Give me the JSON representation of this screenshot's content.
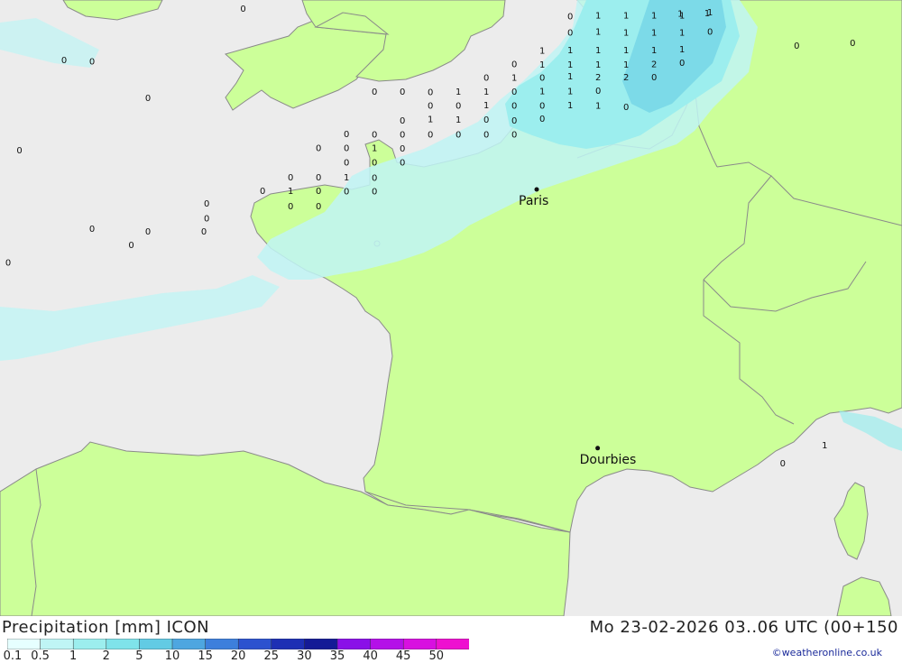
{
  "map": {
    "colors": {
      "sea": "#ececec",
      "land": "#ccff99",
      "border": "#8a8a8a"
    },
    "cities": [
      {
        "name": "Paris",
        "lon": 2.35,
        "lat": 48.85
      },
      {
        "name": "Dourbies",
        "lon": 3.44,
        "lat": 44.07
      }
    ],
    "precip_values": [
      {
        "v": "0",
        "lon": -2.9,
        "lat": 52.18
      },
      {
        "v": "0",
        "lon": -8.4,
        "lat": 51.78
      },
      {
        "v": "0",
        "lon": -7.9,
        "lat": 51.74
      },
      {
        "v": "1",
        "lon": -8.5,
        "lat": 51.43
      },
      {
        "v": "0",
        "lon": -7.9,
        "lat": 51.4
      },
      {
        "v": "0",
        "lon": -6.1,
        "lat": 51.23
      },
      {
        "v": "0",
        "lon": -5.6,
        "lat": 51.21
      },
      {
        "v": "0",
        "lon": 2.95,
        "lat": 52.04
      },
      {
        "v": "1",
        "lon": 3.45,
        "lat": 52.06
      },
      {
        "v": "1",
        "lon": 3.95,
        "lat": 52.06
      },
      {
        "v": "1",
        "lon": 4.45,
        "lat": 52.06
      },
      {
        "v": "1",
        "lon": 4.95,
        "lat": 52.06
      },
      {
        "v": "1",
        "lon": 5.45,
        "lat": 52.12
      },
      {
        "v": "0",
        "lon": 2.95,
        "lat": 51.74
      },
      {
        "v": "1",
        "lon": 3.45,
        "lat": 51.76
      },
      {
        "v": "1",
        "lon": 3.95,
        "lat": 51.74
      },
      {
        "v": "1",
        "lon": 4.45,
        "lat": 51.74
      },
      {
        "v": "1",
        "lon": 4.95,
        "lat": 51.74
      },
      {
        "v": "0",
        "lon": 5.45,
        "lat": 51.76
      },
      {
        "v": "1",
        "lon": 2.45,
        "lat": 51.41
      },
      {
        "v": "1",
        "lon": 2.95,
        "lat": 51.42
      },
      {
        "v": "1",
        "lon": 3.45,
        "lat": 51.42
      },
      {
        "v": "1",
        "lon": 3.95,
        "lat": 51.42
      },
      {
        "v": "1",
        "lon": 4.45,
        "lat": 51.42
      },
      {
        "v": "1",
        "lon": 4.95,
        "lat": 51.43
      },
      {
        "v": "0",
        "lon": 1.95,
        "lat": 51.16
      },
      {
        "v": "1",
        "lon": 2.45,
        "lat": 51.15
      },
      {
        "v": "1",
        "lon": 2.95,
        "lat": 51.15
      },
      {
        "v": "1",
        "lon": 3.45,
        "lat": 51.15
      },
      {
        "v": "1",
        "lon": 3.95,
        "lat": 51.15
      },
      {
        "v": "2",
        "lon": 4.45,
        "lat": 51.16
      },
      {
        "v": "0",
        "lon": 4.95,
        "lat": 51.18
      },
      {
        "v": "0",
        "lon": 1.45,
        "lat": 50.91
      },
      {
        "v": "1",
        "lon": 1.95,
        "lat": 50.91
      },
      {
        "v": "0",
        "lon": 2.45,
        "lat": 50.91
      },
      {
        "v": "1",
        "lon": 2.95,
        "lat": 50.93
      },
      {
        "v": "2",
        "lon": 3.45,
        "lat": 50.92
      },
      {
        "v": "2",
        "lon": 3.95,
        "lat": 50.92
      },
      {
        "v": "0",
        "lon": 4.45,
        "lat": 50.92
      },
      {
        "v": "0",
        "lon": -0.55,
        "lat": 50.65
      },
      {
        "v": "0",
        "lon": -0.05,
        "lat": 50.65
      },
      {
        "v": "0",
        "lon": 0.45,
        "lat": 50.64
      },
      {
        "v": "1",
        "lon": 0.95,
        "lat": 50.65
      },
      {
        "v": "1",
        "lon": 1.45,
        "lat": 50.65
      },
      {
        "v": "0",
        "lon": 1.95,
        "lat": 50.65
      },
      {
        "v": "1",
        "lon": 2.45,
        "lat": 50.66
      },
      {
        "v": "1",
        "lon": 2.95,
        "lat": 50.66
      },
      {
        "v": "0",
        "lon": 3.45,
        "lat": 50.67
      },
      {
        "v": "0",
        "lon": -4.6,
        "lat": 50.53
      },
      {
        "v": "0",
        "lon": 0.45,
        "lat": 50.39
      },
      {
        "v": "0",
        "lon": 0.95,
        "lat": 50.39
      },
      {
        "v": "1",
        "lon": 1.45,
        "lat": 50.4
      },
      {
        "v": "0",
        "lon": 1.95,
        "lat": 50.39
      },
      {
        "v": "0",
        "lon": 2.45,
        "lat": 50.39
      },
      {
        "v": "1",
        "lon": 2.95,
        "lat": 50.4
      },
      {
        "v": "1",
        "lon": 3.45,
        "lat": 50.39
      },
      {
        "v": "0",
        "lon": 3.95,
        "lat": 50.37
      },
      {
        "v": "0",
        "lon": -0.05,
        "lat": 50.12
      },
      {
        "v": "1",
        "lon": 0.45,
        "lat": 50.14
      },
      {
        "v": "1",
        "lon": 0.95,
        "lat": 50.13
      },
      {
        "v": "0",
        "lon": 1.45,
        "lat": 50.13
      },
      {
        "v": "0",
        "lon": 1.95,
        "lat": 50.12
      },
      {
        "v": "0",
        "lon": 2.45,
        "lat": 50.15
      },
      {
        "v": "0",
        "lon": -1.05,
        "lat": 49.87
      },
      {
        "v": "0",
        "lon": -0.55,
        "lat": 49.86
      },
      {
        "v": "0",
        "lon": -0.05,
        "lat": 49.86
      },
      {
        "v": "0",
        "lon": 0.45,
        "lat": 49.86
      },
      {
        "v": "0",
        "lon": 0.95,
        "lat": 49.86
      },
      {
        "v": "0",
        "lon": 1.45,
        "lat": 49.86
      },
      {
        "v": "0",
        "lon": 1.95,
        "lat": 49.86
      },
      {
        "v": "0",
        "lon": -7.4,
        "lat": 49.6
      },
      {
        "v": "0",
        "lon": -6.9,
        "lat": 49.57
      },
      {
        "v": "0",
        "lon": -1.55,
        "lat": 49.61
      },
      {
        "v": "0",
        "lon": -1.05,
        "lat": 49.61
      },
      {
        "v": "1",
        "lon": -0.55,
        "lat": 49.61
      },
      {
        "v": "0",
        "lon": -0.05,
        "lat": 49.6
      },
      {
        "v": "0",
        "lon": -1.05,
        "lat": 49.34
      },
      {
        "v": "0",
        "lon": -0.55,
        "lat": 49.34
      },
      {
        "v": "0",
        "lon": -0.05,
        "lat": 49.34
      },
      {
        "v": "0",
        "lon": -2.05,
        "lat": 49.07
      },
      {
        "v": "0",
        "lon": -1.55,
        "lat": 49.07
      },
      {
        "v": "1",
        "lon": -1.05,
        "lat": 49.07
      },
      {
        "v": "0",
        "lon": -0.55,
        "lat": 49.06
      },
      {
        "v": "0",
        "lon": -2.55,
        "lat": 48.82
      },
      {
        "v": "1",
        "lon": -2.05,
        "lat": 48.82
      },
      {
        "v": "0",
        "lon": -1.55,
        "lat": 48.82
      },
      {
        "v": "0",
        "lon": -1.05,
        "lat": 48.81
      },
      {
        "v": "0",
        "lon": -0.55,
        "lat": 48.81
      },
      {
        "v": "0",
        "lon": -3.55,
        "lat": 48.58
      },
      {
        "v": "0",
        "lon": -2.05,
        "lat": 48.53
      },
      {
        "v": "0",
        "lon": -1.55,
        "lat": 48.53
      },
      {
        "v": "0",
        "lon": -3.55,
        "lat": 48.31
      },
      {
        "v": "0",
        "lon": -5.6,
        "lat": 48.12
      },
      {
        "v": "0",
        "lon": -4.6,
        "lat": 48.07
      },
      {
        "v": "0",
        "lon": -3.6,
        "lat": 48.07
      },
      {
        "v": "0",
        "lon": -4.9,
        "lat": 47.82
      },
      {
        "v": "0",
        "lon": -7.6,
        "lat": 47.52
      },
      {
        "v": "0",
        "lon": -7.1,
        "lat": 47.49
      },
      {
        "v": "0",
        "lon": 7.0,
        "lat": 51.5
      },
      {
        "v": "0",
        "lon": 8.0,
        "lat": 51.55
      },
      {
        "v": "1",
        "lon": 7.5,
        "lat": 44.12
      },
      {
        "v": "0",
        "lon": 6.75,
        "lat": 43.78
      },
      {
        "v": "1",
        "lon": 4.92,
        "lat": 52.09
      },
      {
        "v": "1",
        "lon": 5.4,
        "lat": 52.1
      }
    ]
  },
  "footer": {
    "title": "Precipitation [mm] ICON",
    "datetime": "Mo 23-02-2026 03..06 UTC (00+150",
    "credit": "©weatheronline.co.uk",
    "legend": {
      "ticks": [
        "0.1",
        "0.5",
        "1",
        "2",
        "5",
        "10",
        "15",
        "20",
        "25",
        "30",
        "35",
        "40",
        "45",
        "50"
      ],
      "colors": [
        "#e6ffff",
        "#bff5f5",
        "#9ceeee",
        "#7fe3ea",
        "#62cbe4",
        "#4ea6e0",
        "#3d7fdc",
        "#2c52cf",
        "#1d2fb4",
        "#141a96",
        "#8a10e8",
        "#b410e8",
        "#d810e0",
        "#ee10d0",
        "#c010b0"
      ]
    }
  }
}
